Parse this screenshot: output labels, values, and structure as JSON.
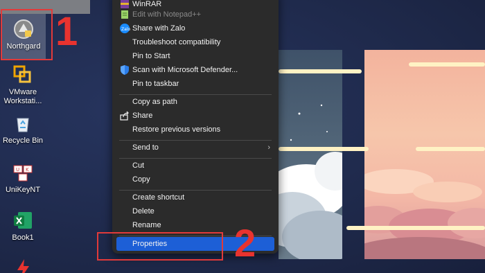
{
  "desktop": {
    "icons": [
      {
        "label": "Northgard",
        "icon": "northgard-icon"
      },
      {
        "label": "VMware Workstati...",
        "icon": "vmware-icon"
      },
      {
        "label": "Recycle Bin",
        "icon": "recycle-bin-icon"
      },
      {
        "label": "UniKeyNT",
        "icon": "unikey-icon"
      },
      {
        "label": "Book1",
        "icon": "excel-icon"
      },
      {
        "label": "",
        "icon": "app-icon"
      }
    ]
  },
  "annotations": {
    "step1": "1",
    "step2": "2",
    "highlight_color": "#e23a3a"
  },
  "context_menu": {
    "items": [
      {
        "label": "WinRAR",
        "icon": "winrar-icon",
        "enabled": true
      },
      {
        "label": "Edit with Notepad++",
        "icon": "notepad-plus-icon",
        "enabled": false
      },
      {
        "label": "Share with Zalo",
        "icon": "zalo-icon",
        "enabled": true
      },
      {
        "label": "Troubleshoot compatibility",
        "icon": "",
        "enabled": true
      },
      {
        "label": "Pin to Start",
        "icon": "",
        "enabled": true
      },
      {
        "label": "Scan with Microsoft Defender...",
        "icon": "defender-shield-icon",
        "enabled": true
      },
      {
        "label": "Pin to taskbar",
        "icon": "",
        "enabled": true
      },
      {
        "label": "Copy as path",
        "icon": "",
        "enabled": true
      },
      {
        "label": "Share",
        "icon": "share-icon",
        "enabled": true
      },
      {
        "label": "Restore previous versions",
        "icon": "",
        "enabled": true
      },
      {
        "label": "Send to",
        "icon": "chevron-right-icon",
        "enabled": true
      },
      {
        "label": "Cut",
        "icon": "",
        "enabled": true
      },
      {
        "label": "Copy",
        "icon": "",
        "enabled": true
      },
      {
        "label": "Create shortcut",
        "icon": "",
        "enabled": true
      },
      {
        "label": "Delete",
        "icon": "",
        "enabled": true
      },
      {
        "label": "Rename",
        "icon": "",
        "enabled": true
      },
      {
        "label": "Properties",
        "icon": "",
        "enabled": true,
        "selected": true
      }
    ],
    "selected_color": "#1d5fd6"
  }
}
